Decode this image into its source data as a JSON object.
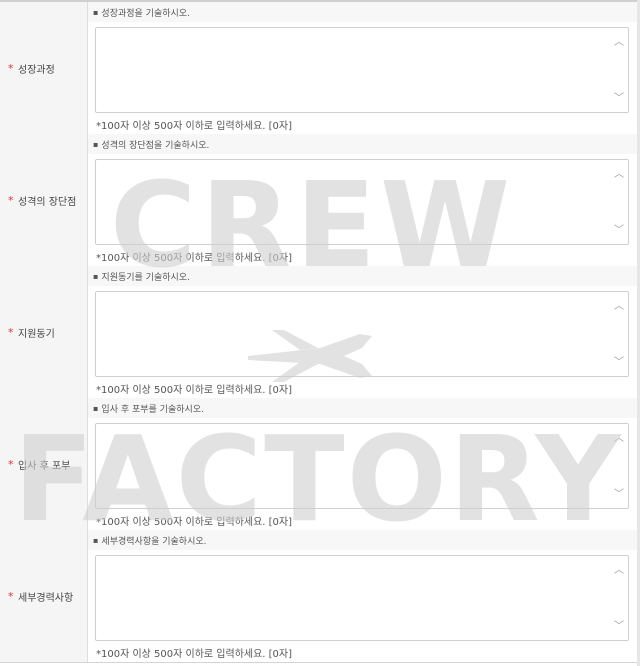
{
  "form": {
    "sections": [
      {
        "label": "성장과정",
        "hint": "성장과정을 기술하시오.",
        "counter": "*100자 이상 500자 이하로 입력하세요. [0자]"
      },
      {
        "label": "성격의 장단점",
        "hint": "성격의 장단점을 기술하시오.",
        "counter": "*100자 이상 500자 이하로 입력하세요. [0자]"
      },
      {
        "label": "지원동기",
        "hint": "지원동기를 기술하시오.",
        "counter": "*100자 이상 500자 이하로 입력하세요. [0자]"
      },
      {
        "label": "입사 후 포부",
        "hint": "입사 후 포부를 기술하시오.",
        "counter": "*100자 이상 500자 이하로 입력하세요. [0자]"
      },
      {
        "label": "세부경력사항",
        "hint": "세부경력사항을 기술하시오.",
        "counter": "*100자 이상 500자 이하로 입력하세요. [0자]"
      }
    ],
    "required_mark": "*"
  },
  "watermark": {
    "line1": "CREW",
    "line2": "FACTORY",
    "color": "#dcdcdc"
  },
  "icons": {
    "scroll_up": "chevron-up-icon",
    "scroll_down": "chevron-down-icon",
    "airplane": "airplane-icon"
  }
}
